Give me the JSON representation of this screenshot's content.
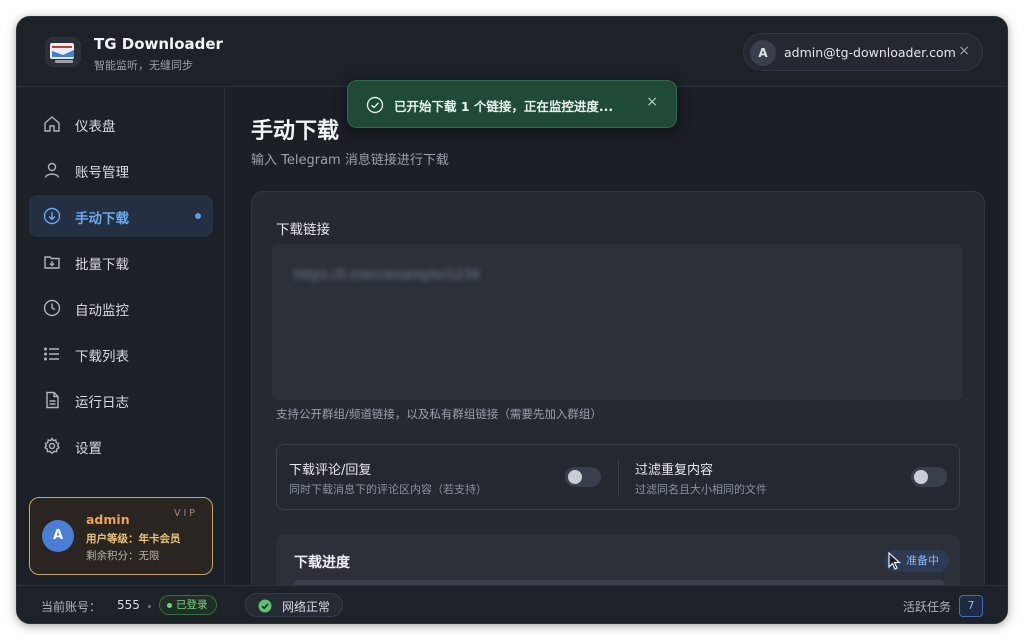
{
  "app": {
    "title": "TG Downloader",
    "subtitle": "智能监听，无缝同步"
  },
  "user": {
    "avatar": "A",
    "email": "admin@tg-downloader.com",
    "close": "×"
  },
  "sidebar": {
    "items": [
      {
        "label": "仪表盘",
        "icon": "home-icon"
      },
      {
        "label": "账号管理",
        "icon": "user-icon"
      },
      {
        "label": "手动下载",
        "icon": "cloud-download-icon",
        "active": true
      },
      {
        "label": "批量下载",
        "icon": "folder-download-icon"
      },
      {
        "label": "自动监控",
        "icon": "clock-icon"
      },
      {
        "label": "下载列表",
        "icon": "list-icon"
      },
      {
        "label": "运行日志",
        "icon": "file-icon"
      },
      {
        "label": "设置",
        "icon": "gear-icon"
      }
    ]
  },
  "vip": {
    "avatar": "A",
    "name": "admin",
    "badge": "VIP",
    "level": "用户等级：年卡会员",
    "points": "剩余积分：无限"
  },
  "page": {
    "title": "手动下载",
    "subtitle": "输入 Telegram 消息链接进行下载"
  },
  "form": {
    "link_label": "下载链接",
    "link_value": "https://t.me/c/example/1234",
    "help": "支持公开群组/频道链接，以及私有群组链接（需要先加入群组）",
    "options": [
      {
        "title": "下载评论/回复",
        "desc": "同时下载消息下的评论区内容（若支持）",
        "enabled": false
      },
      {
        "title": "过滤重复内容",
        "desc": "过滤同名且大小相同的文件",
        "enabled": false
      }
    ]
  },
  "progress": {
    "title": "下载进度",
    "status": "准备中",
    "value": 0
  },
  "status_bar": {
    "account_label": "当前账号：",
    "account_value": "555",
    "login_status": "已登录",
    "network": "网络正常",
    "tasks_label": "活跃任务",
    "tasks_count": "7"
  },
  "toast": {
    "text": "已开始下载 1 个链接，正在监控进度...",
    "close": "×"
  },
  "colors": {
    "accent": "#5b9ff0",
    "success": "#6ed07e",
    "vip_gold": "#c7a46b",
    "toast_bg": "#1f4a35"
  }
}
